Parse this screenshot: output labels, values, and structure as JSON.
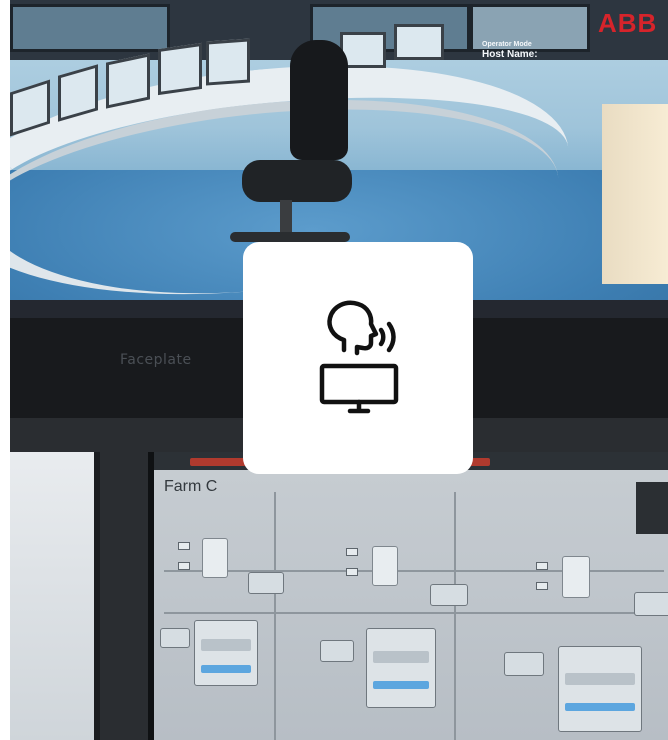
{
  "scene": {
    "brand_logo_text": "ABB",
    "bezel_label": "Faceplate",
    "operator_screen_title": "Farm C",
    "overlay_header": "Operator Mode",
    "overlay_subheader": "Host Name:",
    "icon_card": {
      "icon": "voice-assistant-monitor-icon"
    }
  },
  "colors": {
    "brand_red": "#d6242b",
    "card_bg": "#ffffff",
    "icon_stroke": "#111111"
  }
}
